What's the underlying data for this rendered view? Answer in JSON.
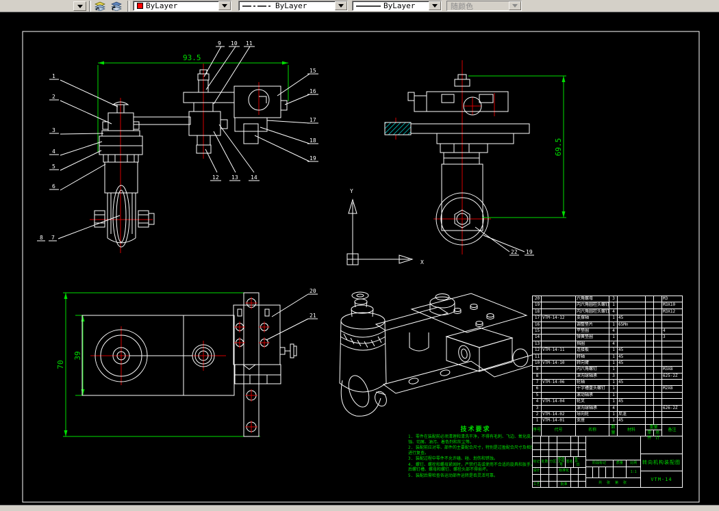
{
  "toolbar": {
    "layer_control": {
      "note": "collapsed layer dropdown"
    },
    "color_control": {
      "value": "ByLayer",
      "swatch_color": "#ff0000"
    },
    "linetype_control": {
      "value": "ByLayer"
    },
    "lineweight_control": {
      "value": "ByLayer"
    },
    "plotstyle_control": {
      "value": "随颜色",
      "disabled": true
    },
    "icons": [
      "make-object-layer-current",
      "layer-previous"
    ]
  },
  "colors": {
    "background": "#000000",
    "line": "#ffffff",
    "dimension_green": "#00df00",
    "centerline_red": "#d40000",
    "hatch_cyan": "#00cccc",
    "toolbar_gray": "#d4d0c8",
    "swatch_red": "#ff0000"
  },
  "drawing": {
    "ucs": {
      "x": "X",
      "y": "Y"
    },
    "dimensions": {
      "front_width": "93.5",
      "side_height": "69.5",
      "top_height": "70",
      "top_inner": "39"
    },
    "callouts": {
      "front": [
        "1",
        "2",
        "3",
        "4",
        "5",
        "6",
        "7",
        "8",
        "9",
        "10",
        "11",
        "12",
        "13",
        "14",
        "15",
        "16",
        "17",
        "18",
        "19"
      ],
      "side": [
        "22",
        "19"
      ],
      "top": [
        "20",
        "21"
      ]
    }
  },
  "notes": {
    "title": "技术要求",
    "items": [
      "1. 零件在装配前必须清理和清洗干净，不得有毛刺、飞边、氧化皮、锈蚀、切屑、油污、着色剂和灰尘等。",
      "2. 装配前应对零、部件的主要配合尺寸，特别是过盈配合尺寸及相关精度进行复查。",
      "3. 装配过程中零件不允许磕、碰、划伤和锈蚀。",
      "4. 螺钉、螺栓和螺母紧固时，严禁打击或使用不合适的旋具和扳手，紧固后螺钉槽、螺母和螺钉、螺栓头部不得损坏。",
      "5. 装配后需检查各运动部件运转是否灵活可靠。"
    ]
  },
  "bom": {
    "headers": {
      "seq": "序号",
      "code": "代号",
      "name": "名称",
      "qty": "数量",
      "mat": "材料",
      "weight": "重量",
      "unit": "单件",
      "total": "总计",
      "note": "备注"
    },
    "rows": [
      {
        "seq": "20",
        "code": "",
        "name": "六角螺母",
        "qty": "3",
        "mat": "",
        "w1": "",
        "w2": "",
        "note": "M3"
      },
      {
        "seq": "19",
        "code": "",
        "name": "内六角圆柱头螺钉",
        "qty": "1",
        "mat": "",
        "w1": "",
        "w2": "",
        "note": "M3X10"
      },
      {
        "seq": "18",
        "code": "",
        "name": "内六角圆柱头螺钉",
        "qty": "4",
        "mat": "",
        "w1": "",
        "w2": "",
        "note": "M3X12"
      },
      {
        "seq": "17",
        "code": "VTM-14-12",
        "name": "支撑轴",
        "qty": "1",
        "mat": "45",
        "w1": "",
        "w2": "",
        "note": ""
      },
      {
        "seq": "16",
        "code": "",
        "name": "调整垫片",
        "qty": "1",
        "mat": "65Mn",
        "w1": "",
        "w2": "",
        "note": ""
      },
      {
        "seq": "15",
        "code": "",
        "name": "平垫圈",
        "qty": "4",
        "mat": "",
        "w1": "",
        "w2": "",
        "note": "4"
      },
      {
        "seq": "14",
        "code": "",
        "name": "弹簧垫圈",
        "qty": "1",
        "mat": "",
        "w1": "",
        "w2": "",
        "note": "3"
      },
      {
        "seq": "13",
        "code": "",
        "name": "挡圈",
        "qty": "4",
        "mat": "",
        "w1": "",
        "w2": "",
        "note": ""
      },
      {
        "seq": "12",
        "code": "VTM-14-11",
        "name": "连接板",
        "qty": "1",
        "mat": "45",
        "w1": "",
        "w2": "",
        "note": ""
      },
      {
        "seq": "11",
        "code": "",
        "name": "转轴",
        "qty": "1",
        "mat": "45",
        "w1": "",
        "w2": "",
        "note": ""
      },
      {
        "seq": "10",
        "code": "VTM-14-10",
        "name": "转向臂",
        "qty": "1",
        "mat": "45",
        "w1": "",
        "w2": "",
        "note": ""
      },
      {
        "seq": "9",
        "code": "",
        "name": "内六角螺钉",
        "qty": "1",
        "mat": "",
        "w1": "",
        "w2": "",
        "note": "M3X8"
      },
      {
        "seq": "8",
        "code": "",
        "name": "深沟球轴承",
        "qty": "3",
        "mat": "",
        "w1": "",
        "w2": "",
        "note": "625-2Z"
      },
      {
        "seq": "7",
        "code": "VTM-14-06",
        "name": "轮轴",
        "qty": "1",
        "mat": "45",
        "w1": "",
        "w2": "",
        "note": ""
      },
      {
        "seq": "6",
        "code": "",
        "name": "十字槽盘头螺钉",
        "qty": "1",
        "mat": "",
        "w1": "",
        "w2": "",
        "note": "M2X8"
      },
      {
        "seq": "5",
        "code": "",
        "name": "滚动轴承",
        "qty": "1",
        "mat": "",
        "w1": "",
        "w2": "",
        "note": ""
      },
      {
        "seq": "4",
        "code": "VTM-14-04",
        "name": "轮叉",
        "qty": "1",
        "mat": "45",
        "w1": "",
        "w2": "",
        "note": ""
      },
      {
        "seq": "3",
        "code": "",
        "name": "深沟球轴承",
        "qty": "4",
        "mat": "",
        "w1": "",
        "w2": "",
        "note": "626-2Z"
      },
      {
        "seq": "2",
        "code": "VTM-14-02",
        "name": "导向轮",
        "qty": "1",
        "mat": "尼龙",
        "w1": "",
        "w2": "",
        "note": ""
      },
      {
        "seq": "1",
        "code": "VTM-14-01",
        "name": "支座",
        "qty": "1",
        "mat": "45",
        "w1": "",
        "w2": "",
        "note": ""
      }
    ]
  },
  "title_block": {
    "change_row": [
      "标记",
      "处数",
      "分区",
      "更改文件号",
      "签名",
      "年、月、日"
    ],
    "design_label": "设计",
    "standard_label": "标准化",
    "process_label": "工艺",
    "approve_label": "批准",
    "stage_label": "阶段标记",
    "weight_label": "质量",
    "scale_label": "比例",
    "scale_value": "1:1",
    "sheet_label": "共 张 第 张",
    "title": "转向机构装配图",
    "drawing_no": "VTM-14"
  }
}
